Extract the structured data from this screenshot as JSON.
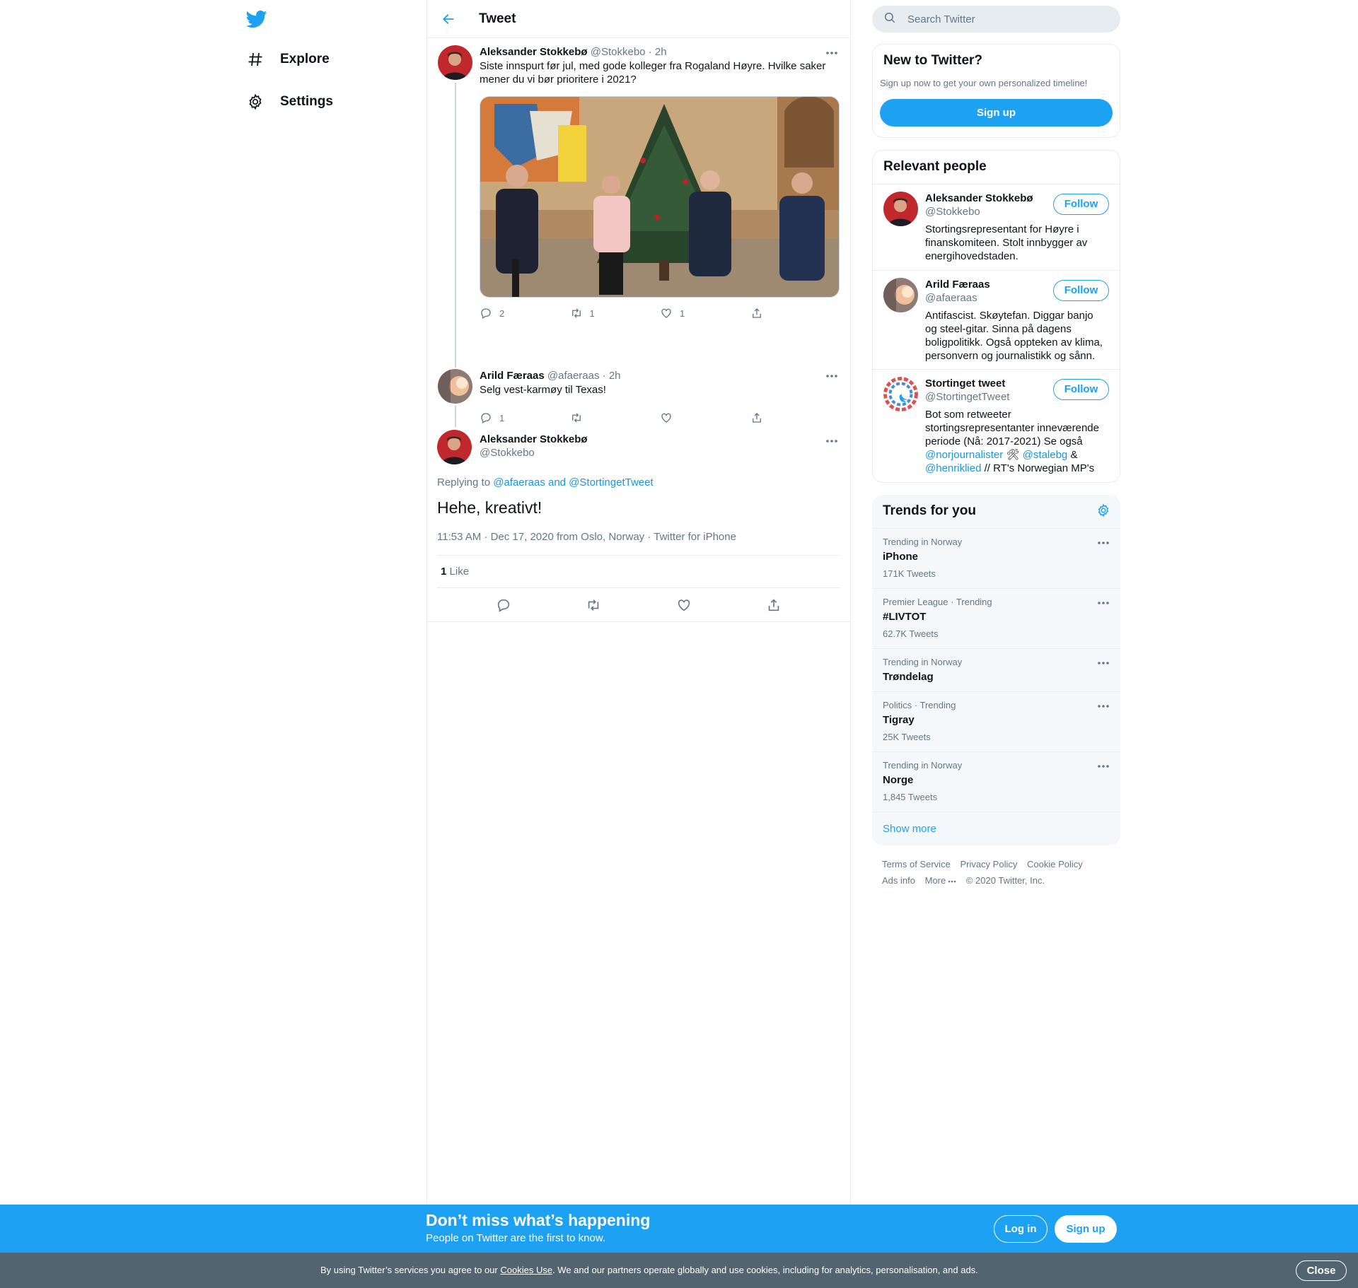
{
  "nav": {
    "explore": "Explore",
    "settings": "Settings"
  },
  "header": {
    "title": "Tweet"
  },
  "thread": [
    {
      "name": "Aleksander Stokkebø",
      "handle": "@Stokkebo",
      "time": "· 2h",
      "text": "Siste innspurt før jul, med gode kolleger fra Rogaland Høyre. Hvilke saker mener du vi bør prioritere i 2021?",
      "replies": "2",
      "retweets": "1",
      "likes": "1"
    },
    {
      "name": "Arild Færaas",
      "handle": "@afaeraas",
      "time": "· 2h",
      "text": "Selg vest-karmøy til Texas!",
      "replies": "1",
      "retweets": "",
      "likes": ""
    }
  ],
  "focus": {
    "name": "Aleksander Stokkebø",
    "handle": "@Stokkebo",
    "replying_prefix": "Replying to ",
    "replying_to": "@afaeraas and @StortingetTweet",
    "text": "Hehe, kreativt!",
    "meta": "11:53 AM · Dec 17, 2020 from Oslo, Norway · Twitter for iPhone",
    "like_count": "1",
    "like_label": "Like"
  },
  "search": {
    "placeholder": "Search Twitter"
  },
  "new_to_twitter": {
    "title": "New to Twitter?",
    "subtitle": "Sign up now to get your own personalized timeline!",
    "button": "Sign up"
  },
  "relevant": {
    "title": "Relevant people",
    "follow_label": "Follow",
    "people": [
      {
        "name": "Aleksander Stokkebø",
        "handle": "@Stokkebo",
        "bio": "Stortingsrepresentant for Høyre i finanskomiteen. Stolt innbygger av energihovedstaden."
      },
      {
        "name": "Arild Færaas",
        "handle": "@afaeraas",
        "bio": "Antifascist. Skøytefan. Diggar banjo og steel-gitar. Sinna på dagens boligpolitikk. Også oppteken av klima, personvern og journalistikk og sånn."
      },
      {
        "name": "Stortinget tweet",
        "handle": "@StortingetTweet",
        "bio_1": "Bot som retweeter stortingsrepresentanter inneværende periode (Nå: 2017-2021) Se også ",
        "mention_1": "@norjournalister",
        "emoji": " 🛠 ",
        "mention_2": "@stalebg",
        "amp": " & ",
        "mention_3": "@henriklied",
        "bio_2": " // RT's Norwegian MP's"
      }
    ]
  },
  "trends": {
    "title": "Trends for you",
    "items": [
      {
        "context": "Trending in Norway",
        "name": "iPhone",
        "count": "171K Tweets"
      },
      {
        "context": "Premier League · Trending",
        "name": "#LIVTOT",
        "count": "62.7K Tweets"
      },
      {
        "context": "Trending in Norway",
        "name": "Trøndelag",
        "count": ""
      },
      {
        "context": "Politics · Trending",
        "name": "Tigray",
        "count": "25K Tweets"
      },
      {
        "context": "Trending in Norway",
        "name": "Norge",
        "count": "1,845 Tweets"
      }
    ],
    "show_more": "Show more"
  },
  "footer": {
    "terms": "Terms of Service",
    "privacy": "Privacy Policy",
    "cookie": "Cookie Policy",
    "ads": "Ads info",
    "more": "More",
    "copyright": "© 2020 Twitter, Inc."
  },
  "bottom_bar": {
    "title": "Don’t miss what’s happening",
    "subtitle": "People on Twitter are the first to know.",
    "login": "Log in",
    "signup": "Sign up"
  },
  "cookie_bar": {
    "prefix": "By using Twitter’s services you agree to our ",
    "link": "Cookies Use",
    "suffix": ". We and our partners operate globally and use cookies, including for analytics, personalisation, and ads.",
    "close": "Close"
  },
  "colors": {
    "accent": "#1da1f2",
    "cookie_bg": "#536471"
  }
}
